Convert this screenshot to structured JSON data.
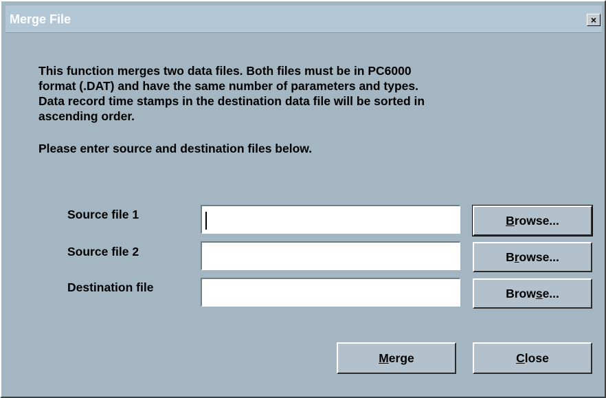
{
  "window": {
    "title": "Merge File",
    "close_glyph": "×"
  },
  "description": {
    "line1": "This function merges two data files.  Both files must be in PC6000",
    "line2": "format (.DAT) and have the same number of parameters and types.",
    "line3": "Data record time stamps in the destination data file will be sorted in",
    "line4": "ascending order."
  },
  "prompt": "Please enter source and destination files below.",
  "fields": {
    "source1": {
      "label": "Source file 1",
      "value": ""
    },
    "source2": {
      "label": "Source file 2",
      "value": ""
    },
    "destination": {
      "label": "Destination file",
      "value": ""
    }
  },
  "buttons": {
    "browse1": {
      "pre": "",
      "underlined": "B",
      "post": "rowse..."
    },
    "browse2": {
      "pre": "B",
      "underlined": "r",
      "post": "owse..."
    },
    "browse3": {
      "pre": "Brow",
      "underlined": "s",
      "post": "e..."
    },
    "merge": {
      "pre": "",
      "underlined": "M",
      "post": "erge"
    },
    "close": {
      "pre": "",
      "underlined": "C",
      "post": "lose"
    }
  },
  "colors": {
    "dialog_background": "#a3b6c2",
    "titlebar": "#b3c7d6"
  }
}
